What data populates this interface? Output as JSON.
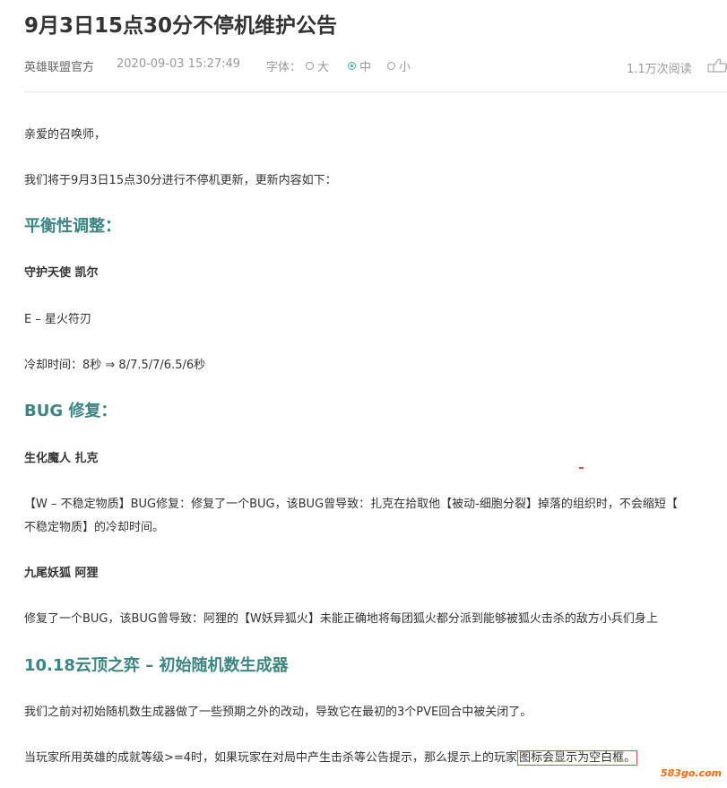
{
  "article": {
    "title": "9月3日15点30分不停机维护公告",
    "author": "英雄联盟官方",
    "date": "2020-09-03 15:27:49",
    "font_label": "字体：",
    "font_options": [
      "大",
      "中",
      "小"
    ],
    "font_selected": "中",
    "views": "1.1万次阅读"
  },
  "content": {
    "greeting": "亲爱的召唤师，",
    "intro": "我们将于9月3日15点30分进行不停机更新，更新内容如下：",
    "balance_heading": "平衡性调整：",
    "kayle_name": "守护天使 凯尔",
    "kayle_ability": "E – 星火符刃",
    "kayle_cooldown": "冷却时间：8秒 ⇒ 8/7.5/7/6.5/6秒",
    "bug_heading": "BUG 修复：",
    "zac_name": "生化魔人 扎克",
    "zac_fix_line1": "【W – 不稳定物质】BUG修复：修复了一个BUG，该BUG曾导致：扎克在拾取他【被动-细胞分裂】掉落的组织时，不会缩短【",
    "zac_fix_line2": "不稳定物质】的冷却时间。",
    "ahri_name": "九尾妖狐 阿狸",
    "ahri_fix": "修复了一个BUG，该BUG曾导致：阿狸的【W妖异狐火】未能正确地将每团狐火都分派到能够被狐火击杀的敌方小兵们身上",
    "tft_heading": "10.18云顶之弈 – 初始随机数生成器",
    "tft_text1": "我们之前对初始随机数生成器做了一些预期之外的改动，导致它在最初的3个PVE回合中被关闭了。",
    "tft_text2_prefix": "当玩家所用英雄的成就等级>=4时，如果玩家在对局中产生击杀等公告提示，那么提示上的玩家",
    "tft_text2_highlight": "图标会显示为空白框。"
  },
  "watermark": "583go.com",
  "colors": {
    "heading": "#3b8583",
    "radio_accent": "#3aa7a0",
    "highlight_border": "#d9534f",
    "watermark": "#ff6600"
  }
}
